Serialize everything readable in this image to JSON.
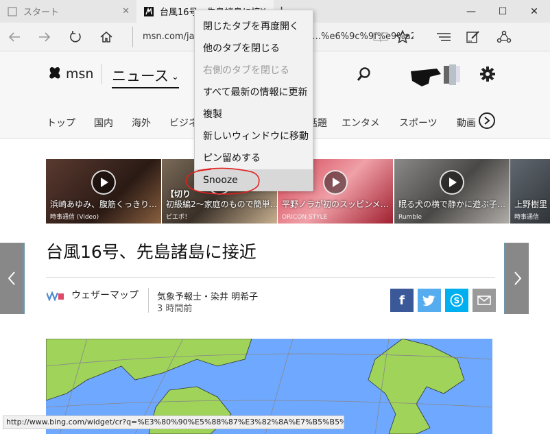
{
  "window": {
    "tabs": [
      {
        "title": "スタート",
        "active": false
      },
      {
        "title": "台風16号、先島諸島に接",
        "active": true
      }
    ],
    "new_tab": "+",
    "controls": {
      "minimize": "—",
      "maximize": "☐",
      "close": "✕"
    }
  },
  "toolbar": {
    "address": "msn.com/ja-jp/news/national/台風16号…%e6%9c%9f%e9%a2%a8"
  },
  "msn": {
    "logo_text": "msn",
    "section": "ニュース",
    "nav": [
      "トップ",
      "国内",
      "海外",
      "ビジネ",
      "話題",
      "エンタメ",
      "スポーツ",
      "動画"
    ]
  },
  "videos": [
    {
      "title": "浜崎あゆみ、腹筋くっきり…",
      "source": "時事通信 (Video)",
      "overlay": ""
    },
    {
      "title": "初級編2〜家庭のもので簡単…",
      "source": "ピエボ！",
      "overlay": "【切り"
    },
    {
      "title": "平野ノラが初のスッピンメ…",
      "source": "ORICON STYLE",
      "overlay": ""
    },
    {
      "title": "眠る犬の横で静かに遊ぶ子…",
      "source": "Rumble",
      "overlay": ""
    },
    {
      "title": "上野樹里",
      "source": "時事通信",
      "overlay": ""
    }
  ],
  "article": {
    "headline": "台風16号、先島諸島に接近",
    "provider": "ウェザーマップ",
    "author": "気象予報士・染井 明希子",
    "time": "3 時間前"
  },
  "colors": {
    "facebook": "#3b5998",
    "twitter": "#55acee",
    "skype": "#00aff0",
    "mail": "#9a9a9a",
    "map_sea": "#6fa8ff",
    "map_land": "#9fd35a",
    "annotation": "#e02020"
  },
  "context_menu": {
    "items": [
      {
        "label": "閉じたタブを再度開く",
        "disabled": false
      },
      {
        "label": "他のタブを閉じる",
        "disabled": false
      },
      {
        "label": "右側のタブを閉じる",
        "disabled": true
      },
      {
        "label": "すべて最新の情報に更新",
        "disabled": false
      },
      {
        "label": "複製",
        "disabled": false
      },
      {
        "label": "新しいウィンドウに移動",
        "disabled": false
      },
      {
        "label": "ピン留めする",
        "disabled": false
      },
      {
        "label": "Snooze",
        "disabled": false,
        "highlighted": true
      }
    ]
  },
  "status_bar": {
    "url": "http://www.bing.com/widget/cr?q=%E3%80%90%E5%88%87%E3%82%8A%E7%B5%B5%E3%"
  }
}
